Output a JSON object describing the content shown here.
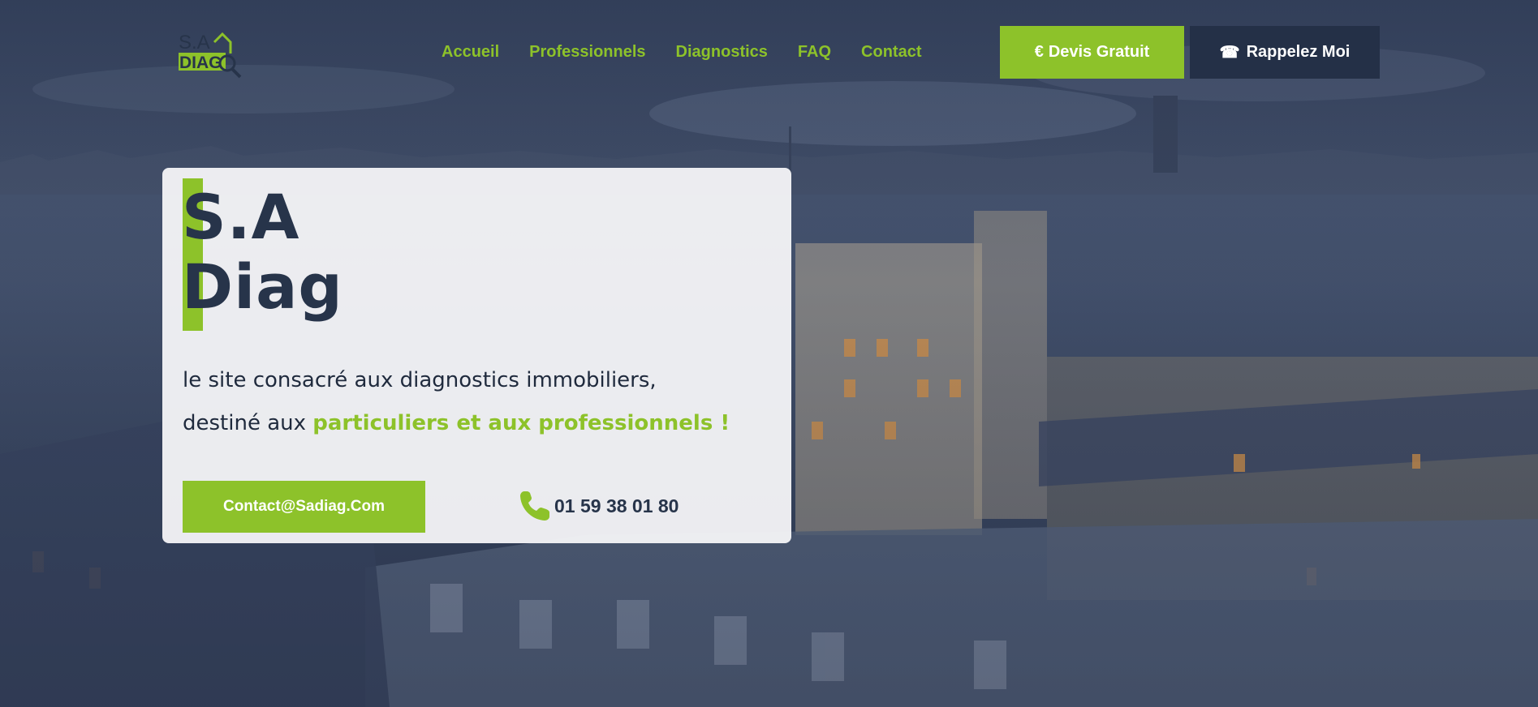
{
  "brand": {
    "logo_text_top": "S.A",
    "logo_text_bottom": "DIAG",
    "colors": {
      "accent": "#8dc22a",
      "dark": "#243047",
      "card": "#f6f7f9"
    }
  },
  "nav": {
    "items": [
      {
        "label": "Accueil"
      },
      {
        "label": "Professionnels"
      },
      {
        "label": "Diagnostics"
      },
      {
        "label": "FAQ"
      },
      {
        "label": "Contact"
      }
    ]
  },
  "header": {
    "devis_icon": "€",
    "devis_label": "Devis Gratuit",
    "rappel_icon": "☎",
    "rappel_label": "Rappelez Moi"
  },
  "hero": {
    "title_line1": "S.A",
    "title_line2": "Diag",
    "tagline_line1": "le site consacré aux diagnostics immobiliers,",
    "tagline_pre": "destiné aux ",
    "tagline_highlight": "particuliers et aux professionnels !",
    "contact_button": "Contact@Sadiag.Com",
    "phone_icon": "phone-icon",
    "phone_number": "01 59 38 01 80"
  }
}
